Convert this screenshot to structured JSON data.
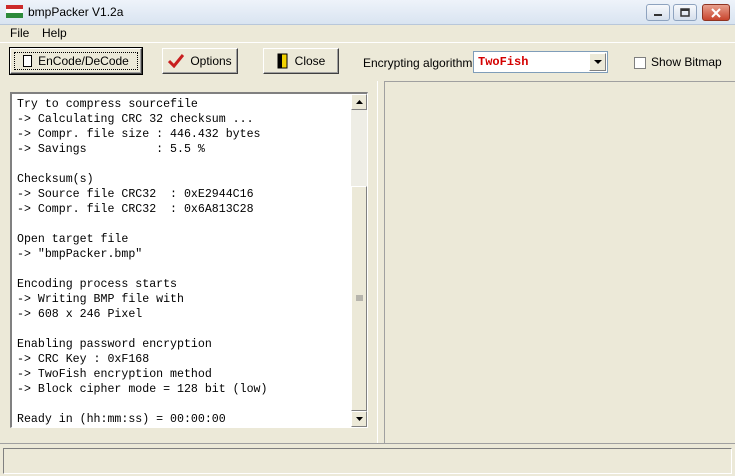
{
  "window": {
    "title": "bmpPacker V1.2a",
    "icons": {
      "app": "flag-icon",
      "minimize": "minimize-icon",
      "maximize": "maximize-icon",
      "close": "close-icon"
    }
  },
  "menu": {
    "file": "File",
    "help": "Help"
  },
  "toolbar": {
    "encode_label": "EnCode/DeCode",
    "options_label": "Options",
    "options_icon": "checkmark-icon",
    "close_label": "Close",
    "close_icon": "door-exit-icon",
    "algorithm_label": "Encrypting algorithm :",
    "algorithm_value": "TwoFish",
    "show_bitmap_label": "Show Bitmap",
    "show_bitmap_checked": false,
    "algorithm_color": "#d40000"
  },
  "log": {
    "lines": [
      "Try to compress sourcefile",
      "-> Calculating CRC 32 checksum ...",
      "-> Compr. file size : 446.432 bytes",
      "-> Savings          : 5.5 %",
      "",
      "Checksum(s)",
      "-> Source file CRC32  : 0xE2944C16",
      "-> Compr. file CRC32  : 0x6A813C28",
      "",
      "Open target file",
      "-> \"bmpPacker.bmp\"",
      "",
      "Encoding process starts",
      "-> Writing BMP file with",
      "-> 608 x 246 Pixel",
      "",
      "Enabling password encryption",
      "-> CRC Key : 0xF168",
      "-> TwoFish encryption method",
      "-> Block cipher mode = 128 bit (low)",
      "",
      "Ready in (hh:mm:ss) = 00:00:00"
    ]
  }
}
